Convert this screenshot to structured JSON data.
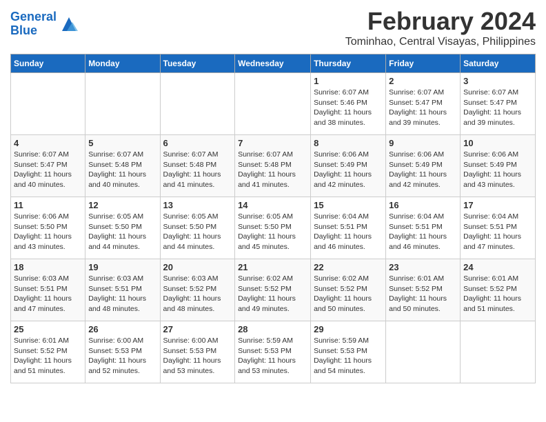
{
  "header": {
    "logo_line1": "General",
    "logo_line2": "Blue",
    "month_year": "February 2024",
    "location": "Tominhao, Central Visayas, Philippines"
  },
  "weekdays": [
    "Sunday",
    "Monday",
    "Tuesday",
    "Wednesday",
    "Thursday",
    "Friday",
    "Saturday"
  ],
  "weeks": [
    [
      {
        "day": "",
        "info": ""
      },
      {
        "day": "",
        "info": ""
      },
      {
        "day": "",
        "info": ""
      },
      {
        "day": "",
        "info": ""
      },
      {
        "day": "1",
        "info": "Sunrise: 6:07 AM\nSunset: 5:46 PM\nDaylight: 11 hours\nand 38 minutes."
      },
      {
        "day": "2",
        "info": "Sunrise: 6:07 AM\nSunset: 5:47 PM\nDaylight: 11 hours\nand 39 minutes."
      },
      {
        "day": "3",
        "info": "Sunrise: 6:07 AM\nSunset: 5:47 PM\nDaylight: 11 hours\nand 39 minutes."
      }
    ],
    [
      {
        "day": "4",
        "info": "Sunrise: 6:07 AM\nSunset: 5:47 PM\nDaylight: 11 hours\nand 40 minutes."
      },
      {
        "day": "5",
        "info": "Sunrise: 6:07 AM\nSunset: 5:48 PM\nDaylight: 11 hours\nand 40 minutes."
      },
      {
        "day": "6",
        "info": "Sunrise: 6:07 AM\nSunset: 5:48 PM\nDaylight: 11 hours\nand 41 minutes."
      },
      {
        "day": "7",
        "info": "Sunrise: 6:07 AM\nSunset: 5:48 PM\nDaylight: 11 hours\nand 41 minutes."
      },
      {
        "day": "8",
        "info": "Sunrise: 6:06 AM\nSunset: 5:49 PM\nDaylight: 11 hours\nand 42 minutes."
      },
      {
        "day": "9",
        "info": "Sunrise: 6:06 AM\nSunset: 5:49 PM\nDaylight: 11 hours\nand 42 minutes."
      },
      {
        "day": "10",
        "info": "Sunrise: 6:06 AM\nSunset: 5:49 PM\nDaylight: 11 hours\nand 43 minutes."
      }
    ],
    [
      {
        "day": "11",
        "info": "Sunrise: 6:06 AM\nSunset: 5:50 PM\nDaylight: 11 hours\nand 43 minutes."
      },
      {
        "day": "12",
        "info": "Sunrise: 6:05 AM\nSunset: 5:50 PM\nDaylight: 11 hours\nand 44 minutes."
      },
      {
        "day": "13",
        "info": "Sunrise: 6:05 AM\nSunset: 5:50 PM\nDaylight: 11 hours\nand 44 minutes."
      },
      {
        "day": "14",
        "info": "Sunrise: 6:05 AM\nSunset: 5:50 PM\nDaylight: 11 hours\nand 45 minutes."
      },
      {
        "day": "15",
        "info": "Sunrise: 6:04 AM\nSunset: 5:51 PM\nDaylight: 11 hours\nand 46 minutes."
      },
      {
        "day": "16",
        "info": "Sunrise: 6:04 AM\nSunset: 5:51 PM\nDaylight: 11 hours\nand 46 minutes."
      },
      {
        "day": "17",
        "info": "Sunrise: 6:04 AM\nSunset: 5:51 PM\nDaylight: 11 hours\nand 47 minutes."
      }
    ],
    [
      {
        "day": "18",
        "info": "Sunrise: 6:03 AM\nSunset: 5:51 PM\nDaylight: 11 hours\nand 47 minutes."
      },
      {
        "day": "19",
        "info": "Sunrise: 6:03 AM\nSunset: 5:51 PM\nDaylight: 11 hours\nand 48 minutes."
      },
      {
        "day": "20",
        "info": "Sunrise: 6:03 AM\nSunset: 5:52 PM\nDaylight: 11 hours\nand 48 minutes."
      },
      {
        "day": "21",
        "info": "Sunrise: 6:02 AM\nSunset: 5:52 PM\nDaylight: 11 hours\nand 49 minutes."
      },
      {
        "day": "22",
        "info": "Sunrise: 6:02 AM\nSunset: 5:52 PM\nDaylight: 11 hours\nand 50 minutes."
      },
      {
        "day": "23",
        "info": "Sunrise: 6:01 AM\nSunset: 5:52 PM\nDaylight: 11 hours\nand 50 minutes."
      },
      {
        "day": "24",
        "info": "Sunrise: 6:01 AM\nSunset: 5:52 PM\nDaylight: 11 hours\nand 51 minutes."
      }
    ],
    [
      {
        "day": "25",
        "info": "Sunrise: 6:01 AM\nSunset: 5:52 PM\nDaylight: 11 hours\nand 51 minutes."
      },
      {
        "day": "26",
        "info": "Sunrise: 6:00 AM\nSunset: 5:53 PM\nDaylight: 11 hours\nand 52 minutes."
      },
      {
        "day": "27",
        "info": "Sunrise: 6:00 AM\nSunset: 5:53 PM\nDaylight: 11 hours\nand 53 minutes."
      },
      {
        "day": "28",
        "info": "Sunrise: 5:59 AM\nSunset: 5:53 PM\nDaylight: 11 hours\nand 53 minutes."
      },
      {
        "day": "29",
        "info": "Sunrise: 5:59 AM\nSunset: 5:53 PM\nDaylight: 11 hours\nand 54 minutes."
      },
      {
        "day": "",
        "info": ""
      },
      {
        "day": "",
        "info": ""
      }
    ]
  ]
}
